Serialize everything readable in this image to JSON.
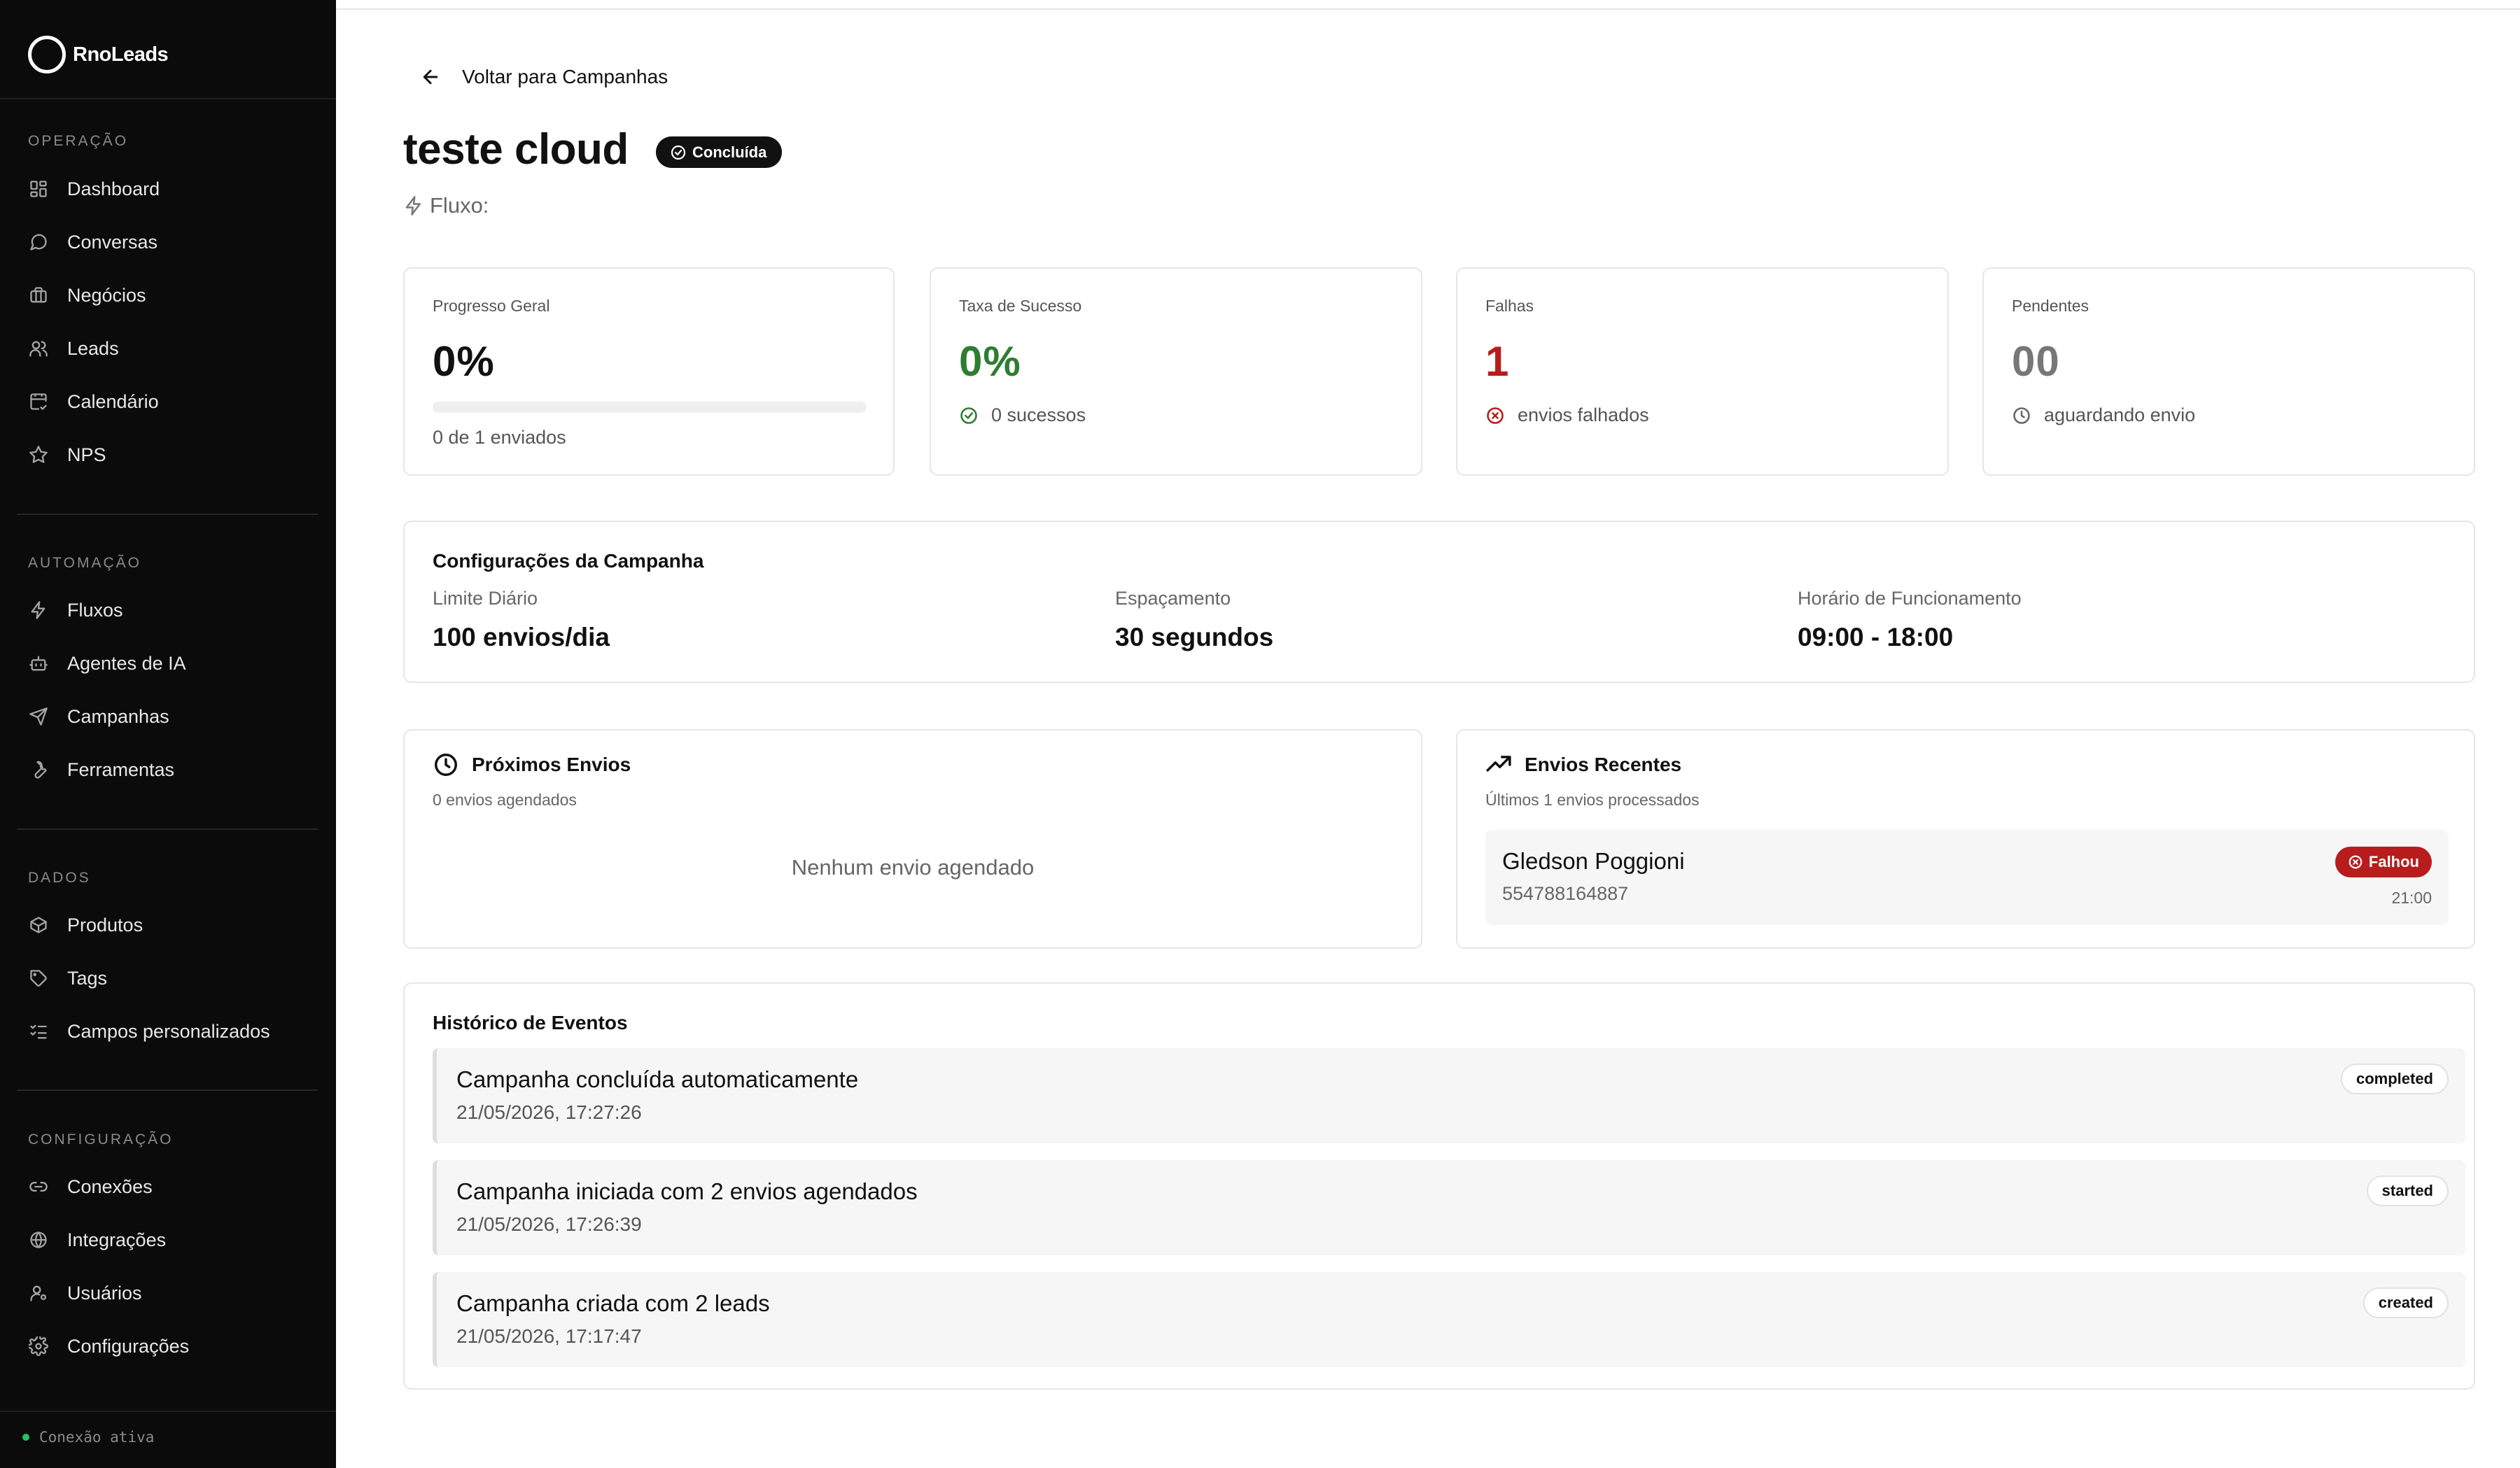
{
  "app": {
    "name": "RnoLeads"
  },
  "sidebar": {
    "sections": [
      {
        "title": "OPERAÇÃO",
        "items": [
          {
            "label": "Dashboard",
            "icon": "dashboard-icon"
          },
          {
            "label": "Conversas",
            "icon": "chat-icon"
          },
          {
            "label": "Negócios",
            "icon": "briefcase-icon"
          },
          {
            "label": "Leads",
            "icon": "users-icon"
          },
          {
            "label": "Calendário",
            "icon": "calendar-check-icon"
          },
          {
            "label": "NPS",
            "icon": "star-icon"
          }
        ]
      },
      {
        "title": "AUTOMAÇÃO",
        "items": [
          {
            "label": "Fluxos",
            "icon": "zap-icon"
          },
          {
            "label": "Agentes de IA",
            "icon": "bot-icon"
          },
          {
            "label": "Campanhas",
            "icon": "send-icon"
          },
          {
            "label": "Ferramentas",
            "icon": "wrench-icon"
          }
        ]
      },
      {
        "title": "DADOS",
        "items": [
          {
            "label": "Produtos",
            "icon": "package-icon"
          },
          {
            "label": "Tags",
            "icon": "tag-icon"
          },
          {
            "label": "Campos personalizados",
            "icon": "list-checks-icon"
          }
        ]
      },
      {
        "title": "CONFIGURAÇÃO",
        "items": [
          {
            "label": "Conexões",
            "icon": "link-icon"
          },
          {
            "label": "Integrações",
            "icon": "globe-icon"
          },
          {
            "label": "Usuários",
            "icon": "user-cog-icon"
          },
          {
            "label": "Configurações",
            "icon": "gear-icon"
          }
        ]
      }
    ],
    "connection_status": "Conexão ativa",
    "connection_color": "#22c55e"
  },
  "header": {
    "back_label": "Voltar para Campanhas",
    "title": "teste cloud",
    "status": "Concluída",
    "flow_label": "Fluxo:"
  },
  "stats": {
    "progress": {
      "label": "Progresso Geral",
      "value": "0%",
      "sub": "0 de 1 enviados",
      "fraction": 0
    },
    "success": {
      "label": "Taxa de Sucesso",
      "value": "0%",
      "sub": "0 sucessos",
      "color": "#2e7d32"
    },
    "failures": {
      "label": "Falhas",
      "value": "1",
      "sub": "envios falhados",
      "color": "#b91c1c"
    },
    "pending": {
      "label": "Pendentes",
      "value": "00",
      "sub": "aguardando envio",
      "color": "#777777"
    }
  },
  "config": {
    "title": "Configurações da Campanha",
    "daily_limit": {
      "label": "Limite Diário",
      "value": "100 envios/dia"
    },
    "spacing": {
      "label": "Espaçamento",
      "value": "30 segundos"
    },
    "hours": {
      "label": "Horário de Funcionamento",
      "value": "09:00 - 18:00"
    }
  },
  "next_sends": {
    "title": "Próximos Envios",
    "subtitle": "0 envios agendados",
    "empty": "Nenhum envio agendado"
  },
  "recent_sends": {
    "title": "Envios Recentes",
    "subtitle": "Últimos 1 envios processados",
    "items": [
      {
        "name": "Gledson Poggioni",
        "phone": "554788164887",
        "status": "Falhou",
        "time": "21:00"
      }
    ]
  },
  "history": {
    "title": "Histórico de Eventos",
    "events": [
      {
        "text": "Campanha concluída automaticamente",
        "time": "21/05/2026, 17:27:26",
        "tag": "completed"
      },
      {
        "text": "Campanha iniciada com 2 envios agendados",
        "time": "21/05/2026, 17:26:39",
        "tag": "started"
      },
      {
        "text": "Campanha criada com 2 leads",
        "time": "21/05/2026, 17:17:47",
        "tag": "created"
      }
    ]
  }
}
